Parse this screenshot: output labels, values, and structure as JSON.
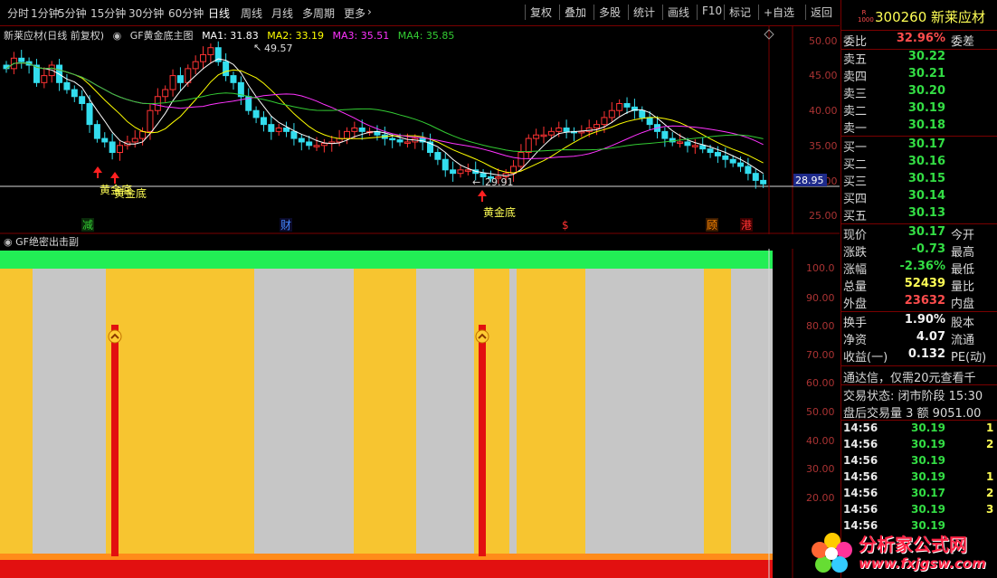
{
  "toolbar": {
    "periods": [
      "分时",
      "1分钟",
      "5分钟",
      "15分钟",
      "30分钟",
      "60分钟",
      "日线",
      "周线",
      "月线",
      "多周期",
      "更多"
    ],
    "active_period": "日线",
    "more_icon": "chevron-right-icon",
    "buttons": [
      "复权",
      "叠加",
      "多股",
      "统计",
      "画线",
      "F10",
      "标记",
      "+自选",
      "返回"
    ]
  },
  "main_chart": {
    "title": "新莱应材(日线 前复权)",
    "indicator": "GF黄金底主图",
    "ma": [
      {
        "label": "MA1: 31.83",
        "color": "#ffffff"
      },
      {
        "label": "MA2: 33.19",
        "color": "#ffff00"
      },
      {
        "label": "MA3: 35.51",
        "color": "#ff33ff"
      },
      {
        "label": "MA4: 35.85",
        "color": "#33cc33"
      }
    ],
    "price_axis": [
      "50.00",
      "45.00",
      "40.00",
      "35.00",
      "30.00",
      "25.00"
    ],
    "current_price_tag": "28.95",
    "high_mark": "49.57",
    "low_mark": "29.91",
    "signal_label": "黄金底",
    "signal_labels_left": [
      "黄金底",
      "黄金底"
    ],
    "events": [
      {
        "text": "减",
        "color": "#33cc33"
      },
      {
        "text": "财",
        "color": "#4488ff"
      },
      {
        "text": "$",
        "color": "#ff3333"
      },
      {
        "text": "顾",
        "color": "#ff8800"
      },
      {
        "text": "港",
        "color": "#ff3333"
      }
    ]
  },
  "sub_chart": {
    "title": "GF绝密出击副",
    "axis": [
      "100.0",
      "90.00",
      "80.00",
      "70.00",
      "60.00",
      "50.00",
      "40.00",
      "30.00",
      "20.00"
    ]
  },
  "quote": {
    "code": "300260",
    "name": "新莱应材",
    "badge_top": "R",
    "badge_bottom": "1000",
    "webi": {
      "label": "委比",
      "value": "32.96%",
      "label2": "委差"
    },
    "sells": [
      {
        "label": "卖五",
        "price": "30.22"
      },
      {
        "label": "卖四",
        "price": "30.21"
      },
      {
        "label": "卖三",
        "price": "30.20"
      },
      {
        "label": "卖二",
        "price": "30.19"
      },
      {
        "label": "卖一",
        "price": "30.18"
      }
    ],
    "buys": [
      {
        "label": "买一",
        "price": "30.17"
      },
      {
        "label": "买二",
        "price": "30.16"
      },
      {
        "label": "买三",
        "price": "30.15"
      },
      {
        "label": "买四",
        "price": "30.14"
      },
      {
        "label": "买五",
        "price": "30.13"
      }
    ],
    "stats": [
      {
        "label": "现价",
        "value": "30.17",
        "label2": "今开",
        "color": "green"
      },
      {
        "label": "涨跌",
        "value": "-0.73",
        "label2": "最高",
        "color": "green"
      },
      {
        "label": "涨幅",
        "value": "-2.36%",
        "label2": "最低",
        "color": "green"
      },
      {
        "label": "总量",
        "value": "52439",
        "label2": "量比",
        "color": "yellow"
      },
      {
        "label": "外盘",
        "value": "23632",
        "label2": "内盘",
        "color": "red"
      }
    ],
    "stats2": [
      {
        "label": "换手",
        "value": "1.90%",
        "label2": "股本"
      },
      {
        "label": "净资",
        "value": "4.07",
        "label2": "流通"
      },
      {
        "label": "收益(一)",
        "value": "0.132",
        "label2": "PE(动)"
      }
    ],
    "notice": "通达信，仅需20元查看千",
    "status": "交易状态: 闭市阶段 15:30",
    "after_hours": "盘后交易量 3 额 9051.00",
    "ticks": [
      {
        "time": "14:56",
        "price": "30.19",
        "vol": "1"
      },
      {
        "time": "14:56",
        "price": "30.19",
        "vol": "2"
      },
      {
        "time": "14:56",
        "price": "30.19",
        "vol": ""
      },
      {
        "time": "14:56",
        "price": "30.19",
        "vol": "1"
      },
      {
        "time": "14:56",
        "price": "30.17",
        "vol": "2"
      },
      {
        "time": "14:56",
        "price": "30.19",
        "vol": "3"
      },
      {
        "time": "14:56",
        "price": "30.19",
        "vol": ""
      }
    ]
  },
  "watermark": {
    "text": "分析家公式网",
    "url": "www.fxjgsw.com"
  }
}
